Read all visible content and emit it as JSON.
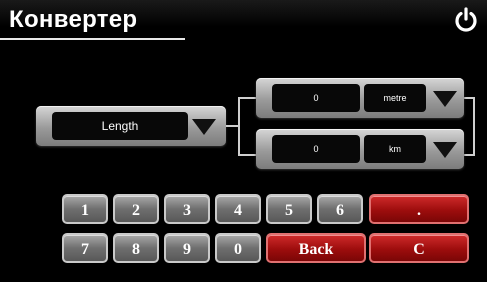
{
  "header": {
    "title": "Конвертер",
    "power_icon": "power-icon"
  },
  "converter": {
    "category": {
      "value": "Length"
    },
    "input": {
      "value": "0",
      "unit": "metre"
    },
    "output": {
      "value": "0",
      "unit": "km"
    }
  },
  "keypad": {
    "row1": [
      "1",
      "2",
      "3",
      "4",
      "5",
      "6"
    ],
    "row2": [
      "7",
      "8",
      "9",
      "0"
    ],
    "dot": ".",
    "back": "Back",
    "clear": "C"
  },
  "colors": {
    "background": "#000000",
    "key_gray": "#6f6f6f",
    "key_red": "#9d0d0d",
    "text": "#ffffff"
  }
}
